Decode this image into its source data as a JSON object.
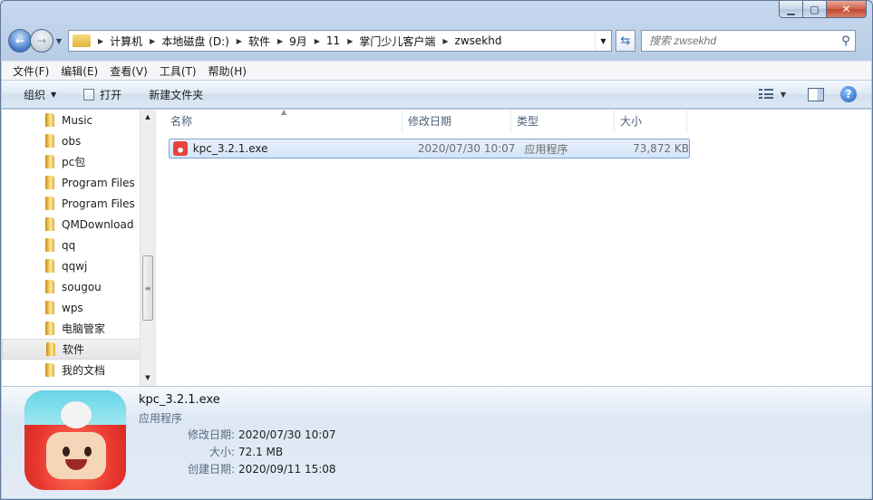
{
  "window": {
    "min_label": "▁",
    "max_label": "▢",
    "close_label": "✕"
  },
  "nav": {
    "back_icon": "arrow-left-icon",
    "crumbs": [
      "计算机",
      "本地磁盘 (D:)",
      "软件",
      "9月",
      "11",
      "掌门少儿客户端",
      "zwsekhd"
    ],
    "search_placeholder": "搜索 zwsekhd"
  },
  "menu": [
    "文件(F)",
    "编辑(E)",
    "查看(V)",
    "工具(T)",
    "帮助(H)"
  ],
  "commands": {
    "organize": "组织",
    "open": "打开",
    "new_folder": "新建文件夹"
  },
  "tree": {
    "items": [
      "Music",
      "obs",
      "pc包",
      "Program Files",
      "Program Files",
      "QMDownload",
      "qq",
      "qqwj",
      "sougou",
      "wps",
      "电脑管家",
      "软件",
      "我的文档"
    ],
    "selected_index": 11
  },
  "columns": {
    "name": "名称",
    "date": "修改日期",
    "type": "类型",
    "size": "大小"
  },
  "files": [
    {
      "name": "kpc_3.2.1.exe",
      "date": "2020/07/30 10:07",
      "type": "应用程序",
      "size": "73,872 KB"
    }
  ],
  "details": {
    "name": "kpc_3.2.1.exe",
    "type": "应用程序",
    "props": [
      {
        "label": "修改日期:",
        "value": "2020/07/30 10:07"
      },
      {
        "label": "大小:",
        "value": "72.1 MB"
      },
      {
        "label": "创建日期:",
        "value": "2020/09/11 15:08"
      }
    ]
  }
}
